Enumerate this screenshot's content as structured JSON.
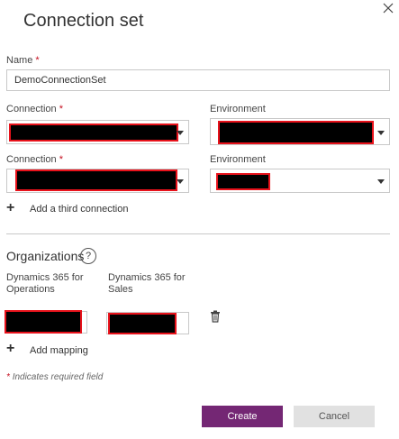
{
  "dialog": {
    "title": "Connection set",
    "close_icon": "close-icon"
  },
  "name_field": {
    "label": "Name",
    "required_mark": "*",
    "value": "DemoConnectionSet"
  },
  "connections": [
    {
      "connection_label": "Connection",
      "required_mark": "*",
      "environment_label": "Environment"
    },
    {
      "connection_label": "Connection",
      "required_mark": "*",
      "environment_label": "Environment"
    }
  ],
  "add_connection": {
    "icon": "plus-icon",
    "label": "Add a third connection"
  },
  "organizations": {
    "title": "Organizations",
    "help_glyph": "?",
    "column1_label": "Dynamics 365 for Operations",
    "column2_label": "Dynamics 365 for Sales"
  },
  "add_mapping": {
    "icon": "plus-icon",
    "label": "Add mapping"
  },
  "required_note": {
    "mark": "*",
    "text": "Indicates required field"
  },
  "buttons": {
    "create": "Create",
    "cancel": "Cancel"
  },
  "colors": {
    "primary_button": "#742774",
    "secondary_button": "#e1e1e1",
    "required": "#c50f1f",
    "redaction_border": "#e8121b"
  }
}
